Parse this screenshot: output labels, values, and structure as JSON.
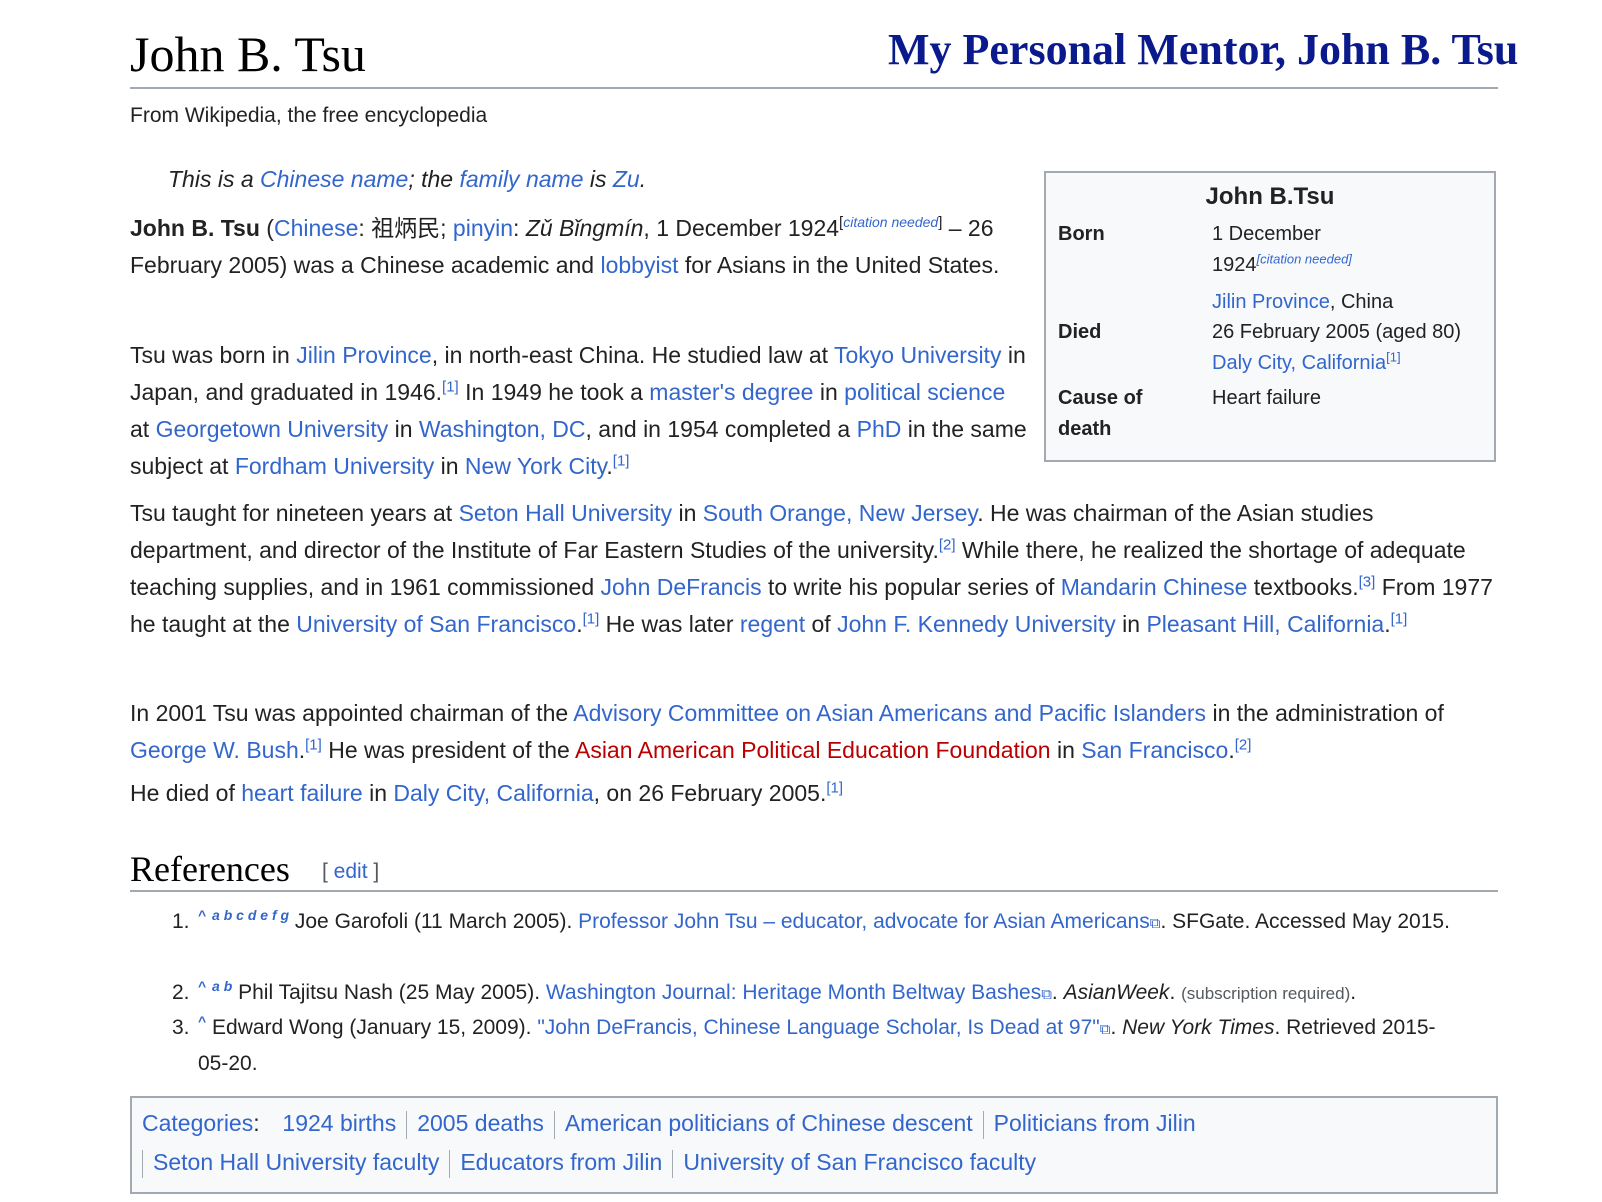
{
  "banner": "My Personal Mentor, John B. Tsu",
  "title": "John B. Tsu",
  "tagline": "From Wikipedia, the free encyclopedia",
  "hatnote": {
    "t1": "This is a ",
    "l1": "Chinese name",
    "t2": "; the ",
    "l2": "family name",
    "t3": " is ",
    "l3": "Zu",
    "t4": "."
  },
  "p1": {
    "name": "John B. Tsu",
    "t1": " (",
    "l_chinese": "Chinese",
    "t2": ": 祖炳民; ",
    "l_pinyin": "pinyin",
    "t3": ": ",
    "pinyin_name": "Zǔ Bǐngmín",
    "t4": ", 1 December 1924",
    "cn_open": "[",
    "cn": "citation needed",
    "cn_close": "]",
    "t5": " – 26 February 2005) was a Chinese academic and ",
    "l_lobbyist": "lobbyist",
    "t6": " for Asians in the United States."
  },
  "p2": {
    "t1": "Tsu was born in ",
    "l_jilin": "Jilin Province",
    "t2": ", in north-east China. He studied law at ",
    "l_tokyo": "Tokyo University",
    "t3": " in Japan, and graduated in 1946.",
    "r1": "[1]",
    "t4": " In 1949 he took a ",
    "l_masters": "master's degree",
    "t5": " in ",
    "l_polisci": "political science",
    "t6": " at ",
    "l_georgetown": "Georgetown University",
    "t7": " in ",
    "l_dc": "Washington, DC",
    "t8": ", and in 1954 completed a ",
    "l_phd": "PhD",
    "t9": " in the same subject at ",
    "l_fordham": "Fordham University",
    "t10": " in ",
    "l_nyc": "New York City",
    "t11": ".",
    "r2": "[1]"
  },
  "p3": {
    "t1": "Tsu taught for nineteen years at ",
    "l_seton": "Seton Hall University",
    "t2": " in ",
    "l_southorange": "South Orange, New Jersey",
    "t3": ". He was chairman of the Asian studies department, and director of the Institute of Far Eastern Studies of the university.",
    "r1": "[2]",
    "t4": " While there, he realized the shortage of adequate teaching supplies, and in 1961 commissioned ",
    "l_defrancis": "John DeFrancis",
    "t5": " to write his popular series of ",
    "l_mandarin": "Mandarin Chinese",
    "t6": " textbooks.",
    "r2": "[3]",
    "t7": " From 1977 he taught at the ",
    "l_usf": "University of San Francisco",
    "t8": ".",
    "r3": "[1]",
    "t9": " He was later ",
    "l_regent": "regent",
    "t10": " of ",
    "l_jfk": "John F. Kennedy University",
    "t11": " in ",
    "l_pleasant": "Pleasant Hill, California",
    "t12": ".",
    "r4": "[1]"
  },
  "p4": {
    "t1": "In 2001 Tsu was appointed chairman of the ",
    "l_advisory": "Advisory Committee on Asian Americans and Pacific Islanders",
    "t2": " in the administration of ",
    "l_bush": "George W. Bush",
    "t3": ".",
    "r1": "[1]",
    "t4": " He was president of the ",
    "l_aapef": "Asian American Political Education Foundation",
    "t5": " in ",
    "l_sf": "San Francisco",
    "t6": ".",
    "r2": "[2]"
  },
  "p5": {
    "t1": "He died of ",
    "l_heart": "heart failure",
    "t2": " in ",
    "l_daly": "Daly City, California",
    "t3": ", on 26 February 2005.",
    "r1": "[1]"
  },
  "infobox": {
    "title": "John B.Tsu",
    "born_label": "Born",
    "born_line1": "1 December",
    "born_line2": "1924",
    "born_cn": "[citation needed]",
    "born_place_link": "Jilin Province",
    "born_place_rest": ", China",
    "died_label": "Died",
    "died_date": "26 February 2005 (aged 80)",
    "died_place_link": "Daly City, California",
    "died_ref": "[1]",
    "cause_label_1": "Cause of",
    "cause_label_2": "death",
    "cause_value": "Heart failure"
  },
  "references": {
    "heading": "References",
    "edit_open": "[ ",
    "edit": "edit",
    "edit_close": " ]",
    "items": [
      {
        "num": "1.",
        "caret": "^",
        "backlinks": "a b c d e f g",
        "t1": " Joe Garofoli (11 March 2005). ",
        "link": "Professor John Tsu – educator, advocate for Asian Americans",
        "t2": ". SFGate. Accessed May 2015."
      },
      {
        "num": "2.",
        "caret": "^",
        "backlinks": "a b",
        "t1": " Phil Tajitsu Nash (25 May 2005). ",
        "link": "Washington Journal: Heritage Month Beltway Bashes",
        "t2": ". ",
        "pub": "AsianWeek",
        "t3": ". ",
        "small": "(subscription required)",
        "t4": "."
      },
      {
        "num": "3.",
        "caret": "^",
        "t1": " Edward Wong (January 15, 2009). ",
        "link": "\"John DeFrancis, Chinese Language Scholar, Is Dead at 97\"",
        "t2": ". ",
        "pub": "New York Times",
        "t3": ". Retrieved 2015-05-20."
      }
    ]
  },
  "categories": {
    "label": "Categories",
    "colon": ":",
    "items": [
      "1924 births",
      "2005 deaths",
      "American politicians of Chinese descent",
      "Politicians from Jilin",
      "Seton Hall University faculty",
      "Educators from Jilin",
      "University of San Francisco faculty"
    ]
  },
  "colors": {
    "link": "#3366cc",
    "redlink": "#ba0000",
    "banner": "#0a1a8c",
    "border": "#a2a9b1"
  },
  "icons": {
    "external_link": "external-link-icon"
  }
}
